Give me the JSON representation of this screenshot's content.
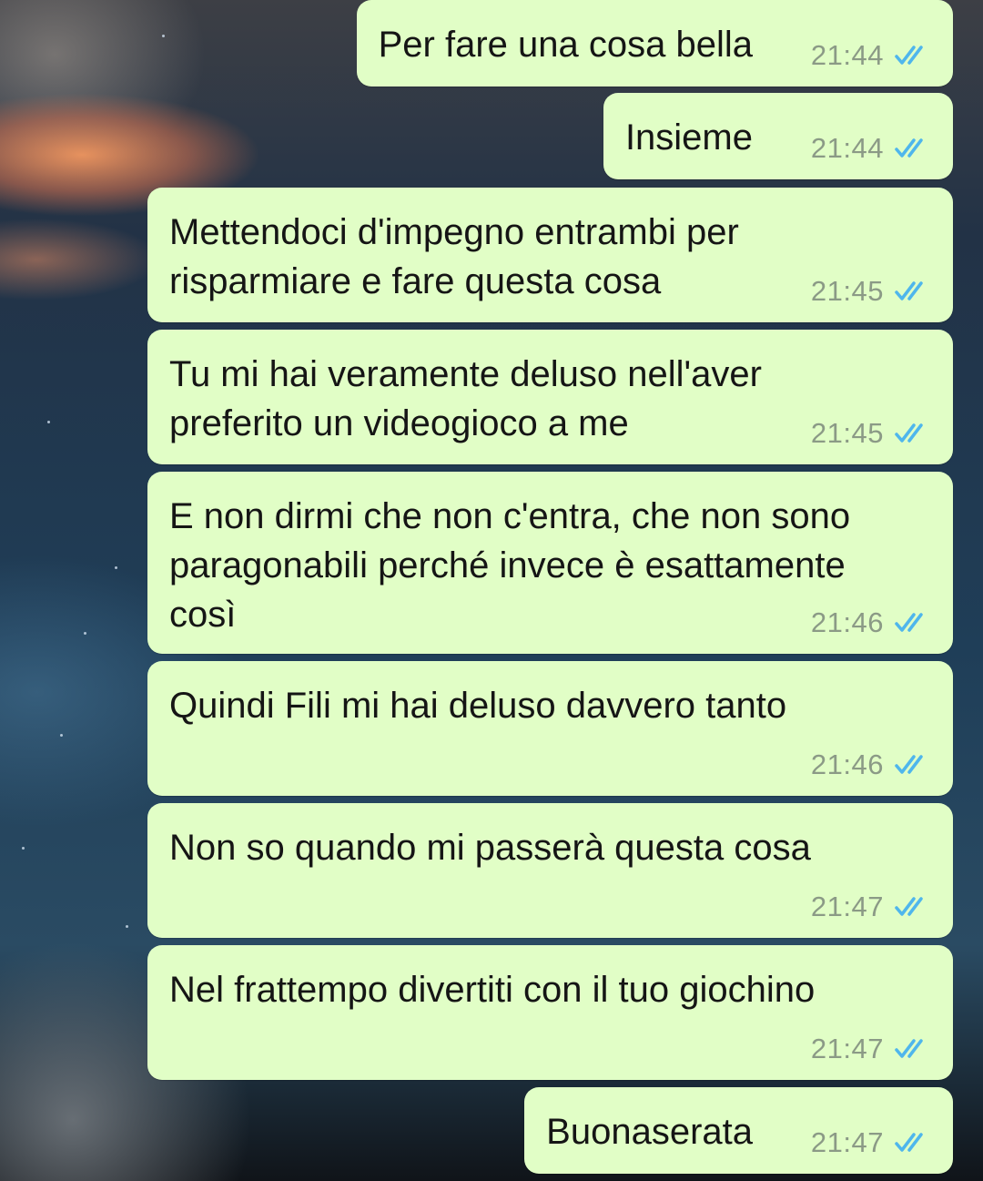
{
  "chat": {
    "messages": [
      {
        "text": "Per fare una cosa bella",
        "time": "21:44",
        "status_icon": "double-check-read-icon"
      },
      {
        "text": "Insieme",
        "time": "21:44",
        "status_icon": "double-check-read-icon"
      },
      {
        "text": "Mettendoci d'impegno entrambi per\nrisparmiare e fare questa cosa",
        "time": "21:45",
        "status_icon": "double-check-read-icon"
      },
      {
        "text": "Tu mi hai veramente deluso nell'aver\npreferito un videogioco a me",
        "time": "21:45",
        "status_icon": "double-check-read-icon"
      },
      {
        "text": "E non dirmi che non c'entra, che non sono\nparagonabili perché invece è esattamente\ncosì",
        "time": "21:46",
        "status_icon": "double-check-read-icon"
      },
      {
        "text": "Quindi Fili mi hai deluso davvero tanto",
        "time": "21:46",
        "status_icon": "double-check-read-icon"
      },
      {
        "text": "Non so quando mi passerà questa cosa",
        "time": "21:47",
        "status_icon": "double-check-read-icon"
      },
      {
        "text": "Nel frattempo divertiti con il tuo giochino",
        "time": "21:47",
        "status_icon": "double-check-read-icon"
      },
      {
        "text": "Buonaserata",
        "time": "21:47",
        "status_icon": "double-check-read-icon"
      }
    ]
  },
  "colors": {
    "outgoing_bubble": "#e1fec6",
    "message_text": "#151515",
    "timestamp": "#8b9a86",
    "read_ticks": "#4fb6ec"
  }
}
